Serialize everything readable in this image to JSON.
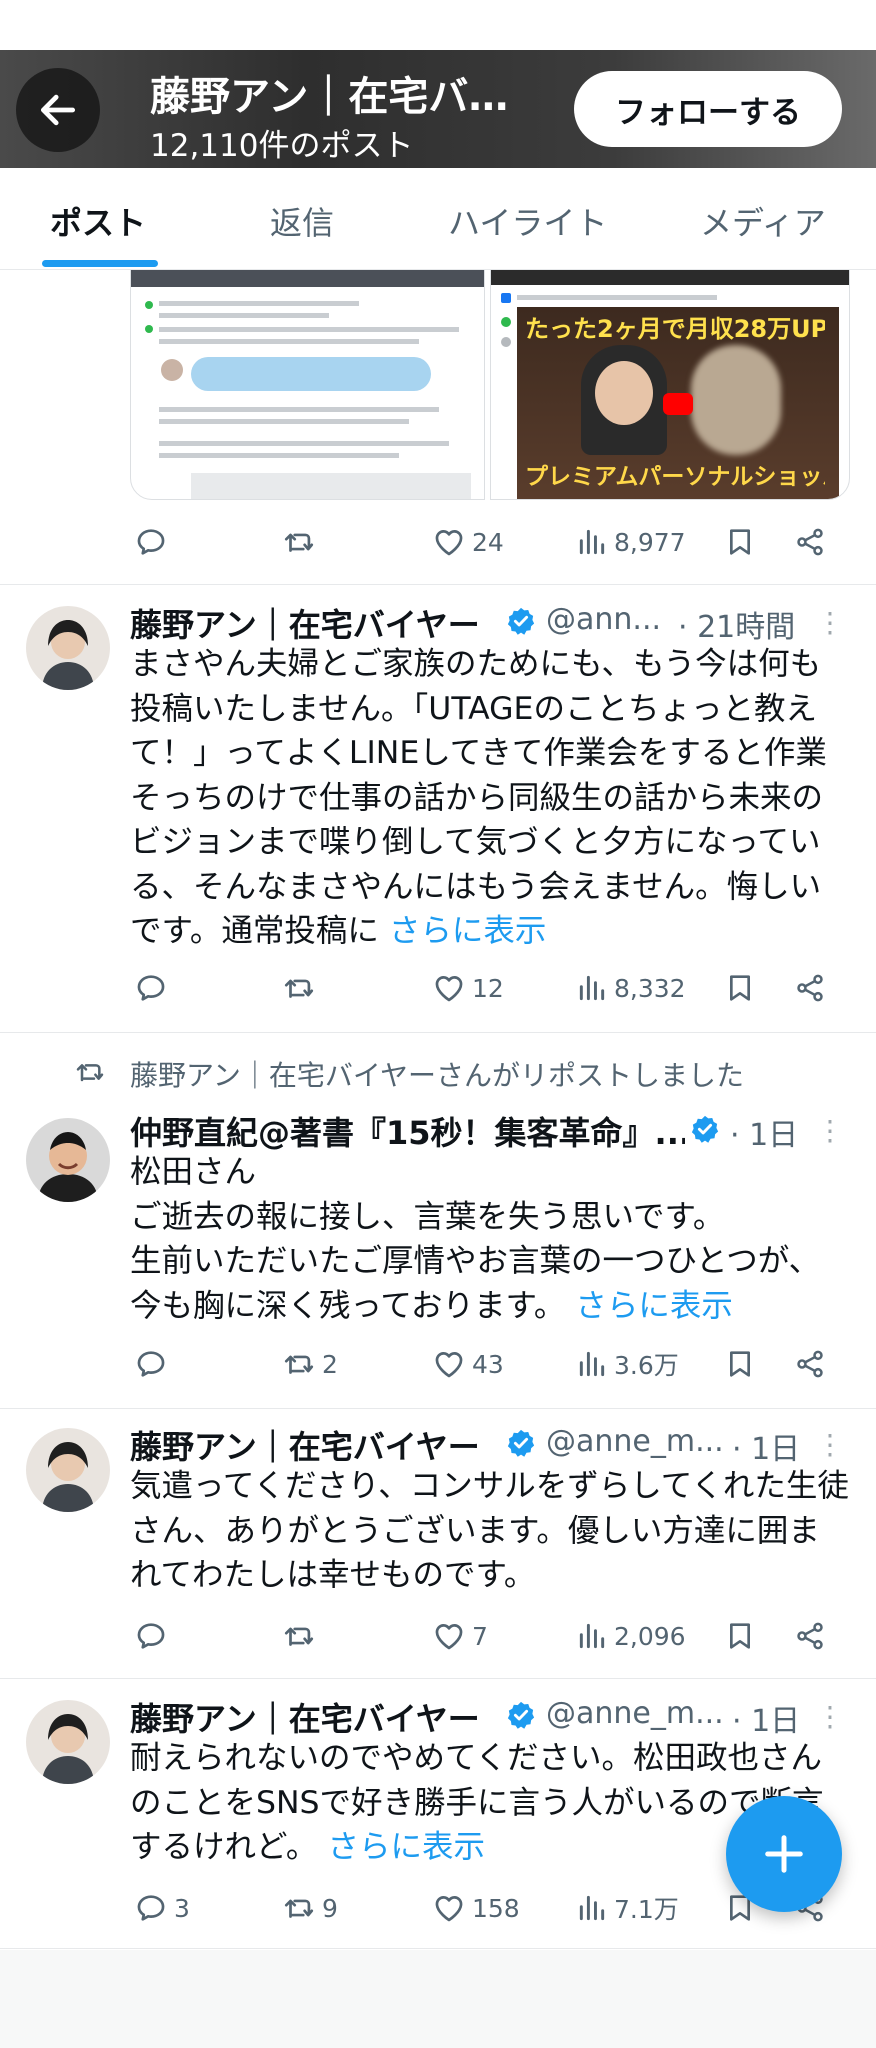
{
  "header": {
    "title": "藤野アン｜在宅バイヤー",
    "post_count": "12,110件のポスト",
    "follow_label": "フォローする"
  },
  "tabs": [
    "ポスト",
    "返信",
    "ハイライト",
    "メディア"
  ],
  "media_preview": {
    "right_caption_top": "たった2ヶ月で月収28万UP!",
    "right_caption_bottom": "プレミアムパーソナルショッパーの本音"
  },
  "top_actions": {
    "replies": "",
    "reposts": "",
    "likes": "24",
    "views": "8,977"
  },
  "tweets": [
    {
      "name": "藤野アン｜在宅バイヤー",
      "handle": "@ann...",
      "time": "· 21時間",
      "body": "まさやん夫婦とご家族のためにも、もう今は何も投稿いたしません。「UTAGEのことちょっと教えて！」ってよくLINEしてきて作業会をすると作業そっちのけで仕事の話から同級生の話から未来のビジョンまで喋り倒して気づくと夕方になっている、そんなまさやんにはもう会えません。悔しいです。通常投稿に ",
      "more": "さらに表示",
      "replies": "",
      "reposts": "",
      "likes": "12",
      "views": "8,332"
    },
    {
      "repost_note": "藤野アン｜在宅バイヤーさんがリポストしました",
      "name": "仲野直紀@著書『15秒！集客革命』...",
      "handle": "",
      "time": "· 1日",
      "body_lines": [
        "松田さん",
        "ご逝去の報に接し、言葉を失う思いです。",
        "生前いただいたご厚情やお言葉の一つひとつが、今も胸に深く残っております。 "
      ],
      "more": "さらに表示",
      "replies": "",
      "reposts": "2",
      "likes": "43",
      "views": "3.6万"
    },
    {
      "name": "藤野アン｜在宅バイヤー",
      "handle": "@anne_m...",
      "time": "· 1日",
      "body": "気遣ってくださり、コンサルをずらしてくれた生徒さん、ありがとうございます。優しい方達に囲まれてわたしは幸せものです。",
      "replies": "",
      "reposts": "",
      "likes": "7",
      "views": "2,096"
    },
    {
      "name": "藤野アン｜在宅バイヤー",
      "handle": "@anne_m...",
      "time": "· 1日",
      "body": "耐えられないのでやめてください。松田政也さんのことをSNSで好き勝手に言う人がいるので断言するけれど。 ",
      "more": "さらに表示",
      "replies": "3",
      "reposts": "9",
      "likes": "158",
      "views": "7.1万"
    }
  ],
  "colors": {
    "accent": "#1d9bf0",
    "text": "#0f1419",
    "muted": "#536471"
  }
}
